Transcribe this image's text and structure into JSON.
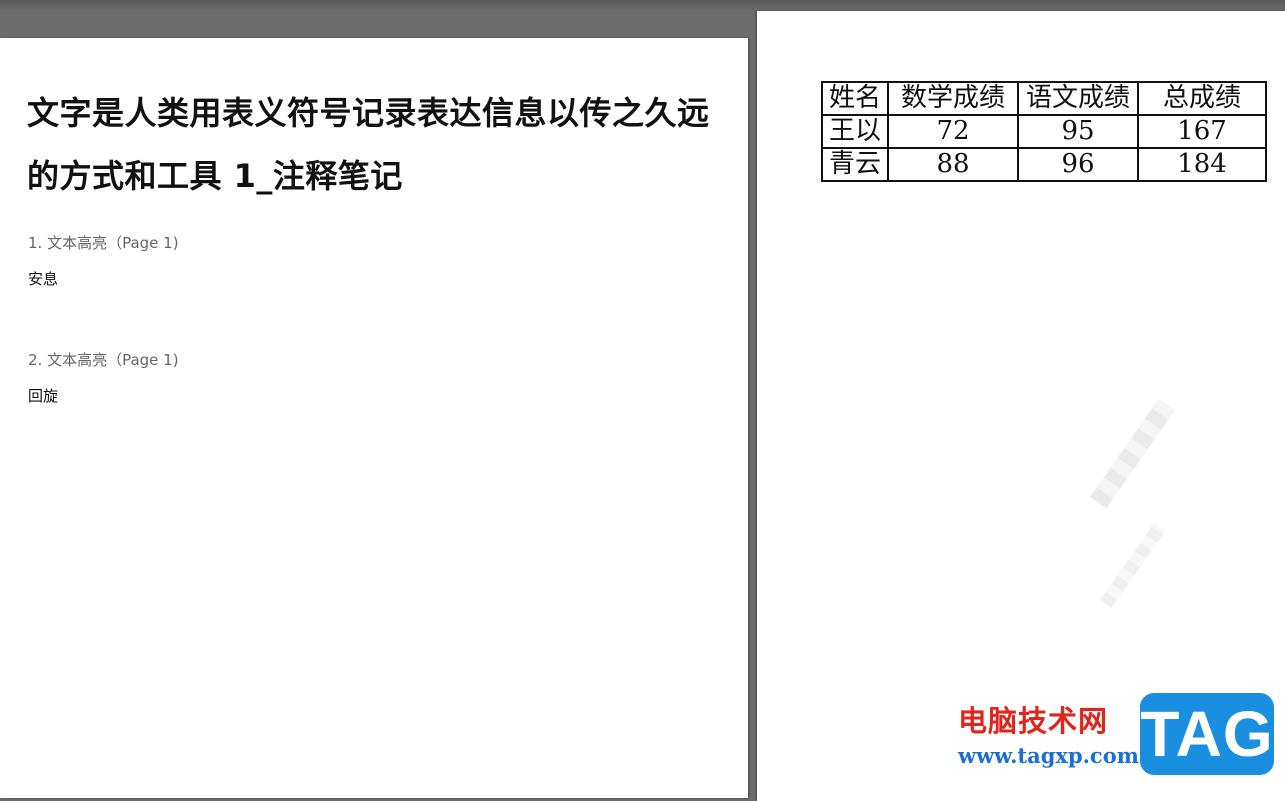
{
  "left_page": {
    "title": "文字是人类用表义符号记录表达信息以传之久远的方式和工具 1_注释笔记",
    "notes": [
      {
        "label": "1. 文本高亮（Page 1)",
        "text": "安息"
      },
      {
        "label": "2. 文本高亮（Page 1)",
        "text": "回旋"
      }
    ]
  },
  "right_page": {
    "table": {
      "headers": [
        "姓名",
        "数学成绩",
        "语文成绩",
        "总成绩"
      ],
      "rows": [
        [
          "王以",
          "72",
          "95",
          "167"
        ],
        [
          "青云",
          "88",
          "96",
          "184"
        ]
      ]
    }
  },
  "watermark": {
    "site_name": "电脑技术网",
    "url": "www.tagxp.com",
    "badge": "TAG",
    "colors": {
      "site_name": "#e0261c",
      "url": "#1a6fd4",
      "badge_bg": "#1a8fe0"
    }
  }
}
